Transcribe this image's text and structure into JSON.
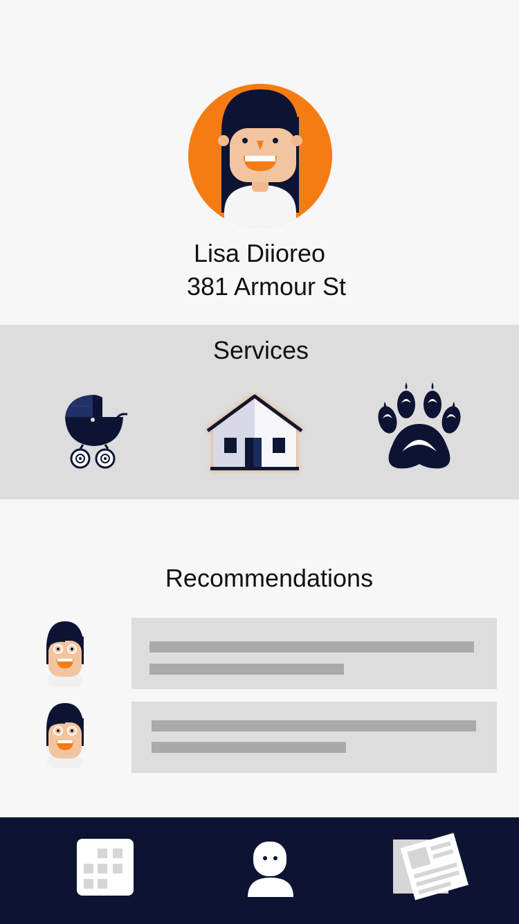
{
  "profile": {
    "name": "Lisa Diioreo",
    "address": "381 Armour St"
  },
  "services": {
    "title": "Services",
    "items": [
      {
        "name": "stroller-icon"
      },
      {
        "name": "house-icon",
        "selected": true
      },
      {
        "name": "paw-icon"
      }
    ]
  },
  "recommendations": {
    "title": "Recommendations",
    "count": 2
  },
  "tabbar": {
    "items": [
      {
        "name": "calendar-icon"
      },
      {
        "name": "person-icon"
      },
      {
        "name": "newspaper-icon"
      }
    ]
  },
  "colors": {
    "accent": "#f57c13",
    "navy": "#0d1433",
    "panel": "#dddddd",
    "background": "#f7f7f7"
  }
}
